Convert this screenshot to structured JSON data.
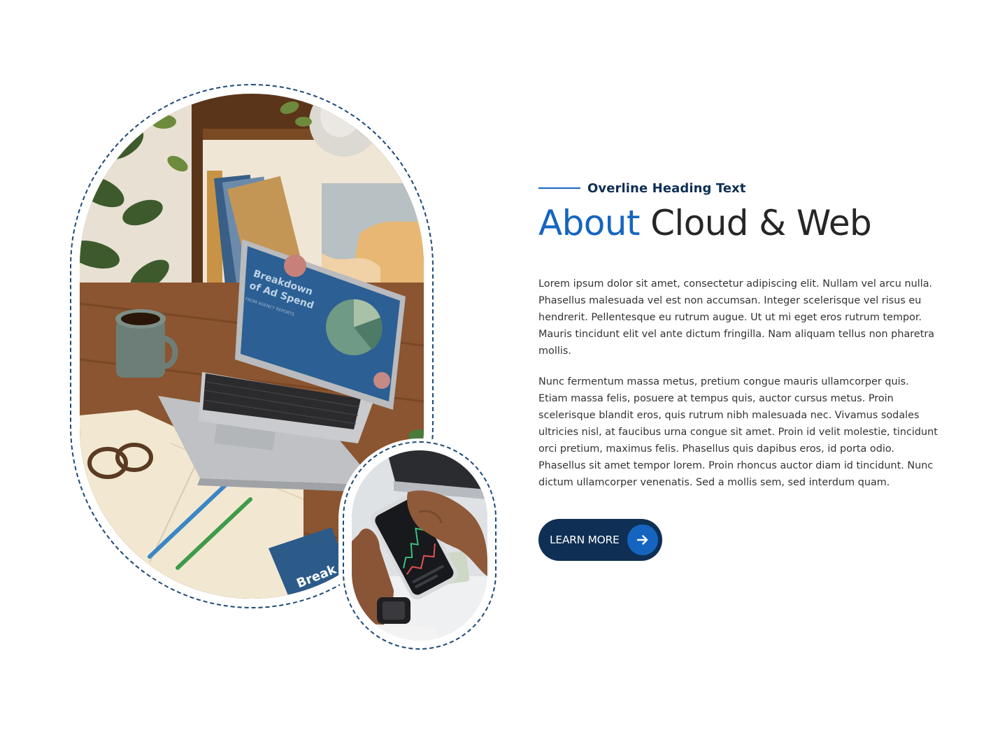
{
  "media": {
    "main_photo_name": "laptop-desk-photo",
    "laptop_screen": {
      "headline": "Breakdown of Ad Spend",
      "headline_line1": "Breakdown",
      "headline_line2": "of Ad Spend",
      "subline": "FROM AGENCY REPORTS"
    },
    "secondary_photo_name": "phone-trading-photo",
    "brochure_text": "Break",
    "dashed_outline_color": "#1d4a78"
  },
  "section": {
    "overline": "Overline Heading Text",
    "title_accent": "About",
    "title_rest": " Cloud & Web",
    "paragraph_1": "Lorem ipsum dolor sit amet, consectetur adipiscing elit. Nullam vel arcu nulla. Phasellus malesuada vel est non accumsan. Integer scelerisque vel risus eu hendrerit. Pellentesque eu rutrum augue. Ut ut mi eget eros rutrum tempor. Mauris tincidunt elit vel ante dictum fringilla. Nam aliquam tellus non pharetra mollis.",
    "paragraph_2": "Nunc fermentum massa metus, pretium congue mauris ullamcorper quis. Etiam massa felis, posuere at tempus quis, auctor cursus metus. Proin scelerisque blandit eros, quis rutrum nibh malesuada nec. Vivamus sodales ultricies nisl, at faucibus urna congue sit amet. Proin id velit molestie, tincidunt orci pretium, maximus felis. Phasellus quis dapibus eros, id porta odio. Phasellus sit amet tempor lorem. Proin rhoncus auctor diam id tincidunt. Nunc dictum ullamcorper venenatis. Sed a mollis sem, sed interdum quam.",
    "cta_label": "LEARN MORE",
    "cta_icon": "arrow-right-icon"
  },
  "colors": {
    "accent": "#1565c0",
    "navy": "#0f2f54",
    "text": "#333333",
    "heading": "#262626"
  }
}
